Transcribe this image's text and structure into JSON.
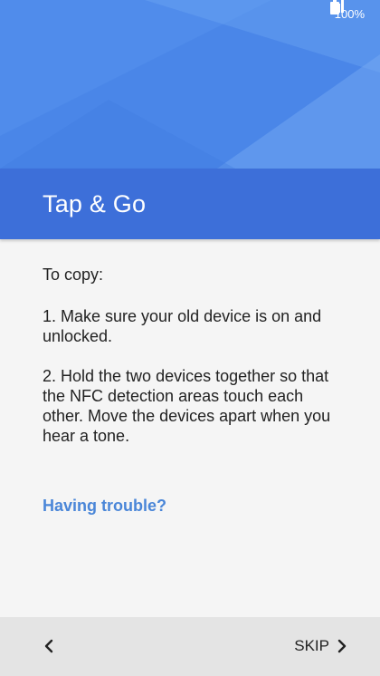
{
  "status_bar": {
    "battery_text": "100%",
    "signal_icon": "signal-icon",
    "battery_icon": "battery-icon"
  },
  "header": {
    "title": "Tap & Go"
  },
  "content": {
    "intro": "To copy:",
    "steps": [
      "1. Make sure your old device is on and unlocked.",
      "2. Hold the two devices together so that the NFC detection areas touch each other. Move the devices apart when you hear a tone."
    ],
    "help_link": "Having trouble?"
  },
  "navigation": {
    "back_icon": "chevron-left-icon",
    "skip_label": "SKIP",
    "skip_icon": "chevron-right-icon"
  },
  "colors": {
    "hero": "#4a86e8",
    "title_bar": "#3d6fd9",
    "link": "#4a86d8",
    "bottom_bar": "#e4e4e4"
  }
}
